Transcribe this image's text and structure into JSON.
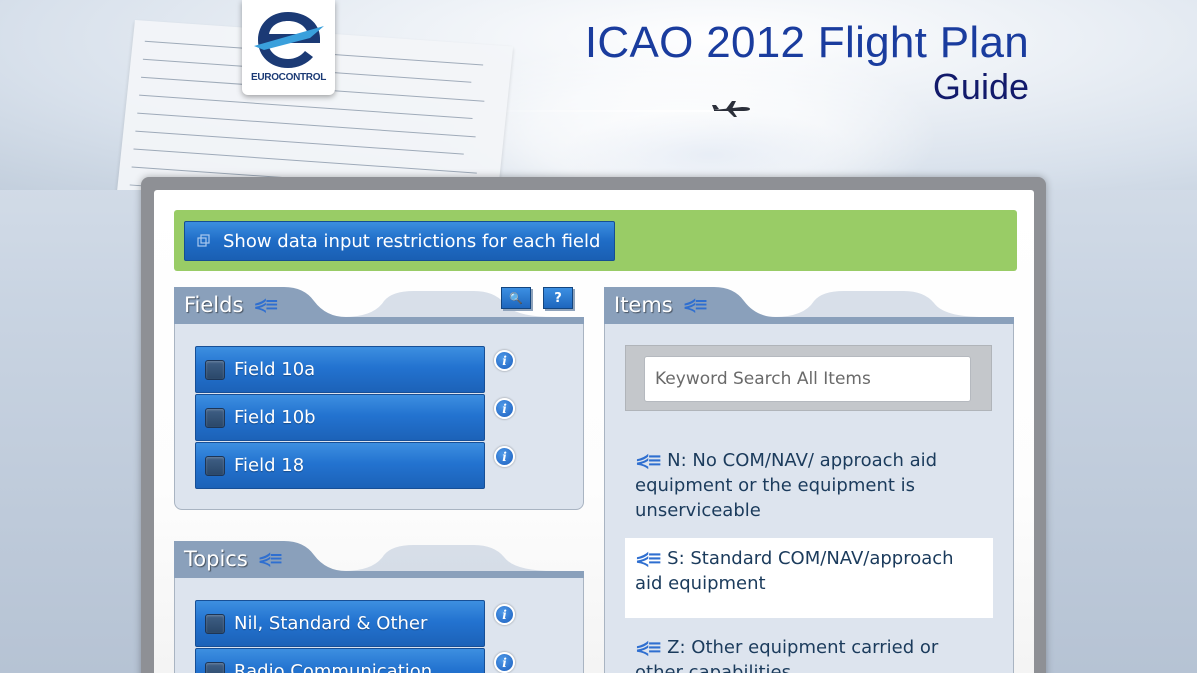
{
  "header": {
    "logo_text": "EUROCONTROL",
    "title_main": "ICAO 2012 Flight Plan",
    "title_sub": "Guide"
  },
  "restrictions": {
    "button_label": "Show data input restrictions for each field"
  },
  "fields_panel": {
    "title": "Fields",
    "search_tool": "🔍",
    "help_tool": "?",
    "items": [
      {
        "label": "Field 10a"
      },
      {
        "label": "Field 10b"
      },
      {
        "label": "Field 18"
      }
    ]
  },
  "topics_panel": {
    "title": "Topics",
    "items": [
      {
        "label": "Nil, Standard & Other"
      },
      {
        "label": "Radio Communication"
      }
    ]
  },
  "items_panel": {
    "title": "Items",
    "search": {
      "placeholder": "Keyword Search All Items"
    },
    "items": [
      {
        "text": "N: No COM/NAV/ approach aid equipment or the equipment is unserviceable"
      },
      {
        "text": "S: Standard COM/NAV/approach aid equipment"
      },
      {
        "text": "Z: Other equipment carried or other capabilities"
      }
    ]
  },
  "icons": {
    "collapse": "⋞≡",
    "info": "i"
  },
  "colors": {
    "accent_blue": "#2373d0",
    "green_bar": "#99cc66",
    "title_blue": "#1a3c9e"
  }
}
